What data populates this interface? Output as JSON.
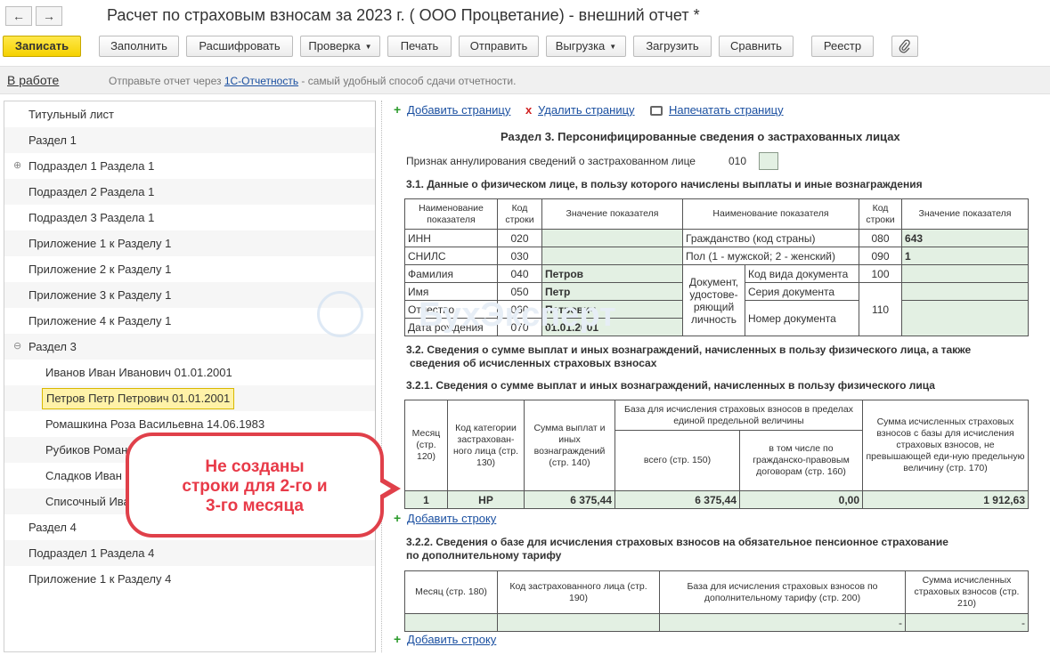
{
  "window": {
    "title": "Расчет по страховым взносам за 2023 г. ( ООО Процветание) - внешний отчет *",
    "back_icon": "←",
    "forward_icon": "→"
  },
  "toolbar": {
    "save": "Записать",
    "fill": "Заполнить",
    "decode": "Расшифровать",
    "check": "Проверка",
    "print": "Печать",
    "send": "Отправить",
    "export": "Выгрузка",
    "load": "Загрузить",
    "compare": "Сравнить",
    "registry": "Реестр",
    "attach_icon": "paperclip-icon",
    "dropdown_glyph": "▼"
  },
  "infobar": {
    "status": "В работе",
    "text_before": "Отправьте отчет через ",
    "link": "1С-Отчетность",
    "text_after": " - самый удобный способ сдачи отчетности."
  },
  "tree": {
    "items": [
      {
        "label": "Титульный лист",
        "indent": 0
      },
      {
        "label": "Раздел 1",
        "indent": 0
      },
      {
        "label": "Подраздел 1 Раздела 1",
        "indent": 0,
        "expander": "⊕"
      },
      {
        "label": "Подраздел 2 Раздела 1",
        "indent": 0
      },
      {
        "label": "Подраздел 3 Раздела 1",
        "indent": 0
      },
      {
        "label": "Приложение 1 к Разделу 1",
        "indent": 0
      },
      {
        "label": "Приложение 2 к Разделу 1",
        "indent": 0
      },
      {
        "label": "Приложение 3 к Разделу 1",
        "indent": 0
      },
      {
        "label": "Приложение 4 к Разделу 1",
        "indent": 0
      },
      {
        "label": "Раздел 3",
        "indent": 0,
        "expander": "⊖"
      },
      {
        "label": "Иванов Иван Иванович 01.01.2001",
        "indent": 1
      },
      {
        "label": "Петров Петр Петрович 01.01.2001",
        "indent": 1,
        "selected": true
      },
      {
        "label": "Ромашкина Роза Васильевна 14.06.1983",
        "indent": 1
      },
      {
        "label": "Рубиков Роман В",
        "indent": 1
      },
      {
        "label": "Сладков Иван",
        "indent": 1
      },
      {
        "label": "Списочный Ива",
        "indent": 1
      },
      {
        "label": "Раздел 4",
        "indent": 0
      },
      {
        "label": "Подраздел 1 Раздела 4",
        "indent": 0
      },
      {
        "label": "Приложение 1 к Разделу 4",
        "indent": 0
      }
    ]
  },
  "form": {
    "add_page": "Добавить страницу",
    "delete_page": "Удалить страницу",
    "print_page": "Напечатать страницу",
    "plus_glyph": "+",
    "x_glyph": "x",
    "section_title": "Раздел 3. Персонифицированные сведения о застрахованных лицах",
    "annul_label": "Признак аннулирования сведений о застрахованном лице",
    "annul_code": "010",
    "s31_title": "3.1. Данные о физическом лице, в пользу которого начислены выплаты и иные вознаграждения",
    "t31": {
      "h_name": "Наименование показателя",
      "h_code": "Код строки",
      "h_value": "Значение показателя",
      "rows_left": [
        {
          "name": "ИНН",
          "code": "020",
          "value": ""
        },
        {
          "name": "СНИЛС",
          "code": "030",
          "value": ""
        },
        {
          "name": "Фамилия",
          "code": "040",
          "value": "Петров"
        },
        {
          "name": "Имя",
          "code": "050",
          "value": "Петр"
        },
        {
          "name": "Отчество",
          "code": "060",
          "value": "Петрович"
        },
        {
          "name": "Дата рождения",
          "code": "070",
          "value": "01.01.2001"
        }
      ],
      "citizenship": "Гражданство (код страны)",
      "citizenship_code": "080",
      "citizenship_value": "643",
      "sex": "Пол (1 - мужской; 2 - женский)",
      "sex_code": "090",
      "sex_value": "1",
      "doc_label": "Документ, удостове-ряющий личность",
      "doc_type": "Код вида документа",
      "doc_type_code": "100",
      "doc_series": "Серия документа",
      "doc_number": "Номер документа",
      "doc_series_code": "110"
    },
    "s32_title_1": "3.2. Сведения о сумме выплат и иных вознаграждений, начисленных в пользу физического лица, а также",
    "s32_title_2": "сведения об исчисленных страховых взносах",
    "s321_title": "3.2.1. Сведения о сумме выплат и иных вознаграждений, начисленных в пользу физического лица",
    "t321": {
      "h_month": "Месяц (стр. 120)",
      "h_cat": "Код категории застрахован-ного лица (стр. 130)",
      "h_sum": "Сумма выплат и иных вознаграждений (стр. 140)",
      "h_base": "База для исчисления страховых взносов в пределах единой предельной величины",
      "h_base_all": "всего (стр. 150)",
      "h_base_gpd": "в том числе по гражданско-правовым договорам (стр. 160)",
      "h_contrib": "Сумма исчисленных страховых взносов с базы для исчисления страховых взносов, не превышающей еди-ную предельную величину (стр. 170)",
      "row": {
        "month": "1",
        "cat": "НР",
        "sum": "6 375,44",
        "base_all": "6 375,44",
        "base_gpd": "0,00",
        "contrib": "1 912,63"
      }
    },
    "add_row": "Добавить строку",
    "s322_title_1": "3.2.2. Сведения о базе для исчисления страховых взносов на обязательное пенсионное страхование",
    "s322_title_2": "по дополнительному тарифу",
    "t322": {
      "h_month": "Месяц (стр. 180)",
      "h_code": "Код застрахованного лица (стр. 190)",
      "h_base": "База для исчисления страховых взносов по дополнительному тарифу (стр. 200)",
      "h_contrib": "Сумма исчисленных страховых взносов (стр. 210)",
      "dash": "-"
    },
    "add_row_2": "Добавить строку"
  },
  "callout": {
    "text": "Не созданы\nстроки для 2-го и\n3-го месяца"
  },
  "watermark": {
    "text": "БухЭксперт"
  }
}
